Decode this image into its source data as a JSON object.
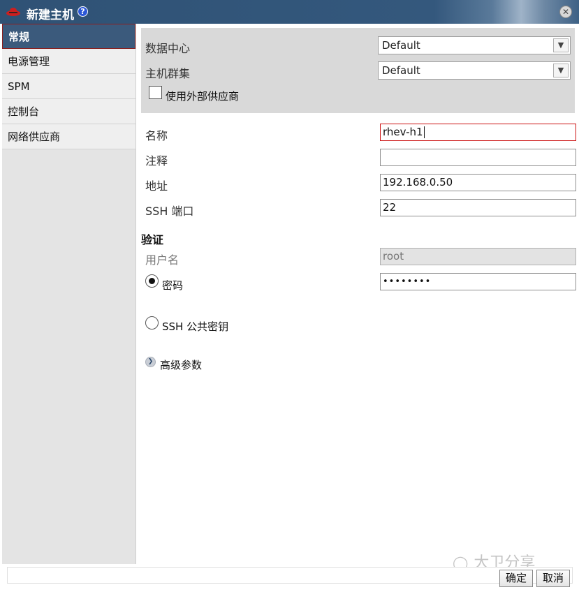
{
  "window": {
    "title": "新建主机",
    "logo_icon": "redhat-logo-icon",
    "help_icon": "?",
    "close_icon": "✕"
  },
  "sidebar": {
    "items": [
      {
        "label": "常规",
        "active": true
      },
      {
        "label": "电源管理"
      },
      {
        "label": "SPM"
      },
      {
        "label": "控制台"
      },
      {
        "label": "网络供应商"
      }
    ]
  },
  "general": {
    "datacenter_label": "数据中心",
    "datacenter_value": "Default",
    "cluster_label": "主机群集",
    "cluster_value": "Default",
    "external_provider_label": "使用外部供应商",
    "name_label": "名称",
    "name_value": "rhev-h1",
    "comment_label": "注释",
    "comment_value": "",
    "address_label": "地址",
    "address_value": "192.168.0.50",
    "ssh_port_label": "SSH 端口",
    "ssh_port_value": "22"
  },
  "auth": {
    "section_label": "验证",
    "username_label": "用户名",
    "username_value": "root",
    "password_radio_label": "密码",
    "password_value": "••••••••",
    "ssh_key_radio_label": "SSH 公共密钥"
  },
  "advanced": {
    "label": "高级参数"
  },
  "footer": {
    "ok_label": "确定",
    "cancel_label": "取消"
  },
  "watermark": {
    "text": "大卫分享"
  }
}
